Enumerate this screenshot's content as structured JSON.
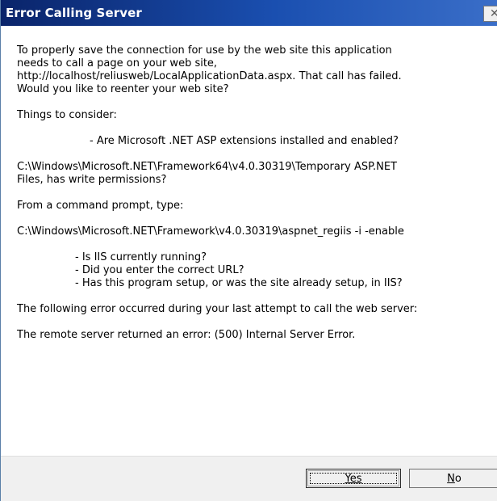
{
  "window": {
    "title": "Error Calling Server",
    "close_glyph": "✕"
  },
  "message": {
    "intro": "To properly save the connection for use by the web site this application\nneeds to call a page on your web site,\nhttp://localhost/reliusweb/LocalApplicationData.aspx.  That call has failed.\nWould you like to reenter your web site?",
    "consider_heading": "Things to consider:",
    "check_aspnet": "- Are Microsoft .NET ASP extensions installed and enabled?",
    "temp_path": "C:\\Windows\\Microsoft.NET\\Framework64\\v4.0.30319\\Temporary ASP.NET\nFiles, has write permissions?",
    "command_prompt": "From a command prompt, type:",
    "command": "C:\\Windows\\Microsoft.NET\\Framework\\v4.0.30319\\aspnet_regiis -i -enable",
    "checklist": [
      "- Is IIS currently running?",
      "- Did you enter the correct URL?",
      "- Has this program setup, or was the site already setup, in IIS?"
    ],
    "error_intro": "The following error occurred during your last attempt to call the web server:",
    "error_detail": "The remote server returned an error: (500) Internal Server Error."
  },
  "buttons": {
    "yes_label": "Yes",
    "no_label": "No"
  }
}
